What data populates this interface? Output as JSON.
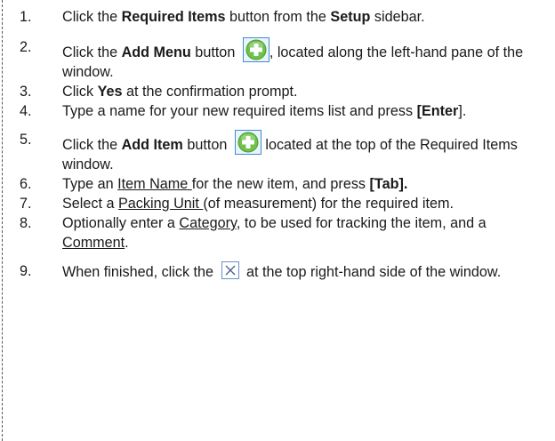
{
  "steps": [
    {
      "num": "1.",
      "parts": [
        {
          "t": "Click the "
        },
        {
          "t": "Required Items",
          "b": true
        },
        {
          "t": " button from the "
        },
        {
          "t": "Setup",
          "b": true
        },
        {
          "t": " sidebar."
        }
      ]
    },
    {
      "num": "2.",
      "parts": [
        {
          "t": "Click the "
        },
        {
          "t": "Add Menu",
          "b": true
        },
        {
          "t": " button "
        },
        {
          "icon": "add-plus-icon"
        },
        {
          "t": ", located along the left-hand pane of the window."
        }
      ]
    },
    {
      "num": "3.",
      "parts": [
        {
          "t": "Click "
        },
        {
          "t": "Yes",
          "b": true
        },
        {
          "t": " at the confirmation prompt."
        }
      ]
    },
    {
      "num": "4.",
      "parts": [
        {
          "t": "Type a name for your new required items list and press "
        },
        {
          "t": "[Enter",
          "b": true
        },
        {
          "t": "]."
        }
      ]
    },
    {
      "num": "5.",
      "parts": [
        {
          "t": "Click the "
        },
        {
          "t": "Add Item",
          "b": true
        },
        {
          "t": " button "
        },
        {
          "icon": "add-plus-icon"
        },
        {
          "t": " located at the top of the Required Items window."
        }
      ]
    },
    {
      "num": "6.",
      "parts": [
        {
          "t": "Type an "
        },
        {
          "t": "Item Name ",
          "u": true
        },
        {
          "t": "for the new item, and press "
        },
        {
          "t": "[Tab].",
          "b": true
        }
      ]
    },
    {
      "num": "7.",
      "parts": [
        {
          "t": "Select a "
        },
        {
          "t": "Packing Unit ",
          "u": true
        },
        {
          "t": "(of measurement) for the required item."
        }
      ]
    },
    {
      "num": "8.",
      "parts": [
        {
          "t": "Optionally enter a "
        },
        {
          "t": "Category",
          "u": true
        },
        {
          "t": ", to be used for tracking the item, and a "
        },
        {
          "t": "Comment",
          "u": true
        },
        {
          "t": "."
        }
      ]
    },
    {
      "num": "9.",
      "parts": [
        {
          "t": "When finished, click the "
        },
        {
          "icon": "close-box-icon"
        },
        {
          "t": " at the top right-hand side of the window."
        }
      ]
    }
  ],
  "colors": {
    "plus_green": "#6cc24a",
    "plus_border": "#3a8fd1",
    "close_border": "#6a8fc8"
  }
}
